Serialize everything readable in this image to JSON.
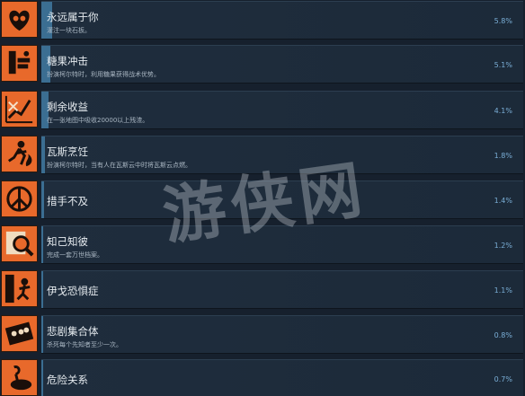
{
  "achievements": [
    {
      "title": "永远属于你",
      "desc": "灌注一块石板。",
      "pct": "5.8%",
      "fill": 0.058,
      "icon": "heart-skull-icon"
    },
    {
      "title": "糖果冲击",
      "desc": "扮演柯尔特时，利用糖果获得战术优势。",
      "pct": "5.1%",
      "fill": 0.051,
      "icon": "candy-hand-icon"
    },
    {
      "title": "剩余收益",
      "desc": "在一张地图中吸收20000以上残渣。",
      "pct": "4.1%",
      "fill": 0.041,
      "icon": "graph-icon"
    },
    {
      "title": "瓦斯烹饪",
      "desc": "扮演柯尔特时，当有人在瓦斯云中时将瓦斯云点燃。",
      "pct": "1.8%",
      "fill": 0.018,
      "icon": "fire-runner-icon"
    },
    {
      "title": "措手不及",
      "desc": "",
      "pct": "1.4%",
      "fill": 0.014,
      "icon": "peace-sign-icon"
    },
    {
      "title": "知己知彼",
      "desc": "完成一套万世档案。",
      "pct": "1.2%",
      "fill": 0.012,
      "icon": "magnifier-icon"
    },
    {
      "title": "伊戈恐惧症",
      "desc": "",
      "pct": "1.1%",
      "fill": 0.011,
      "icon": "falling-figure-icon"
    },
    {
      "title": "悲剧集合体",
      "desc": "杀死每个先知者至少一次。",
      "pct": "0.8%",
      "fill": 0.008,
      "icon": "collage-icon"
    },
    {
      "title": "危险关系",
      "desc": "",
      "pct": "0.7%",
      "fill": 0.007,
      "icon": "flamingo-icon"
    }
  ],
  "watermark": "游侠网"
}
